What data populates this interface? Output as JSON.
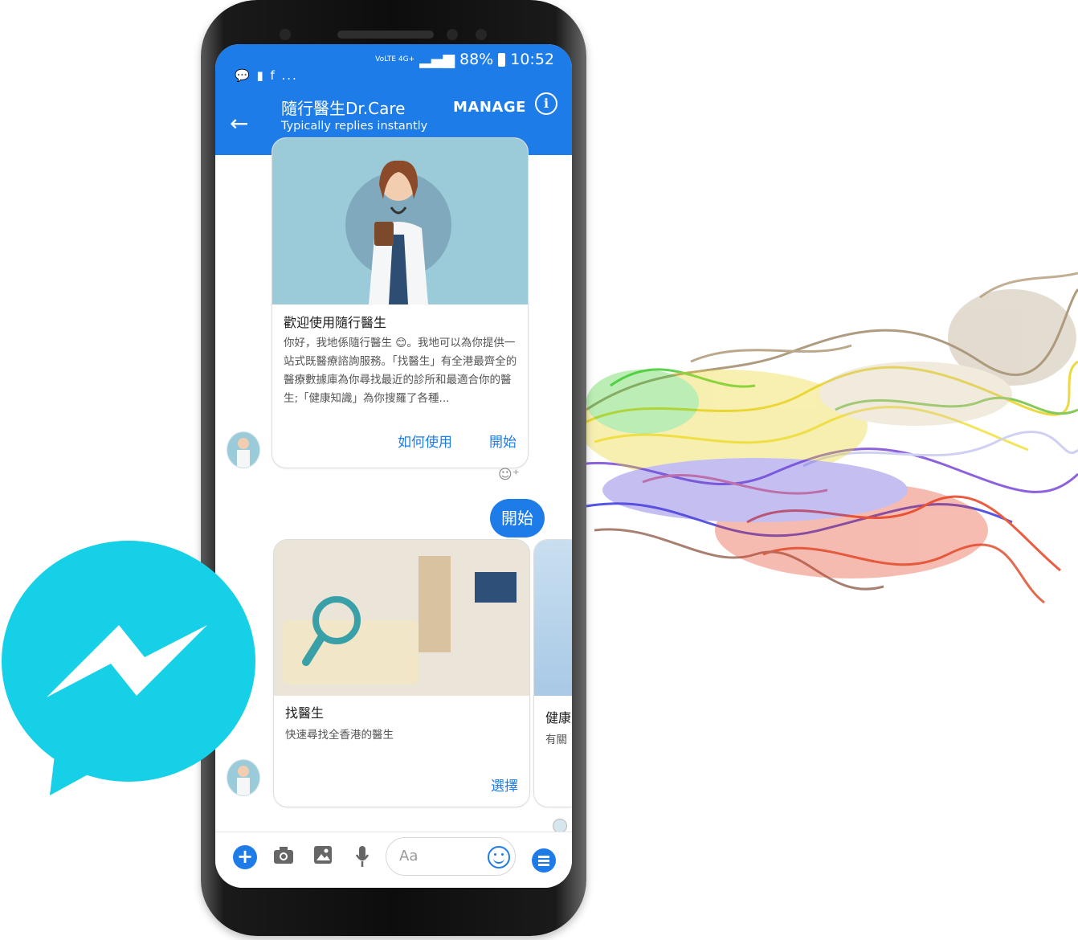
{
  "status_bar": {
    "notifications": "💬 ▮ f ...",
    "network": "VoLTE 4G+",
    "battery": "88%",
    "time": "10:52"
  },
  "header": {
    "title": "隨行醫生Dr.Care",
    "subtitle": "Typically replies instantly",
    "manage_label": "MANAGE",
    "back_icon": "arrow-left-icon",
    "info_icon": "info-icon"
  },
  "messages": {
    "welcome_card": {
      "title": "歡迎使用隨行醫生",
      "body": "你好，我地係隨行醫生 😊。我地可以為你提供一站式既醫療諮詢服務。「找醫生」有全港最齊全的醫療數據庫為你尋找最近的診所和最適合你的醫生;「健康知識」為你搜羅了各種...",
      "buttons": [
        "如何使用",
        "開始"
      ]
    },
    "user_reply": "開始",
    "carousel": [
      {
        "title": "找醫生",
        "body": "快速尋找全香港的醫生",
        "button": "選擇"
      },
      {
        "title": "健康",
        "body": "有關"
      }
    ]
  },
  "composer": {
    "placeholder": "Aa",
    "icons": [
      "plus-icon",
      "camera-icon",
      "image-icon",
      "microphone-icon",
      "emoji-icon",
      "menu-icon"
    ]
  },
  "colors": {
    "messenger_blue": "#1e7ce8",
    "logo_cyan": "#16d0e8"
  }
}
